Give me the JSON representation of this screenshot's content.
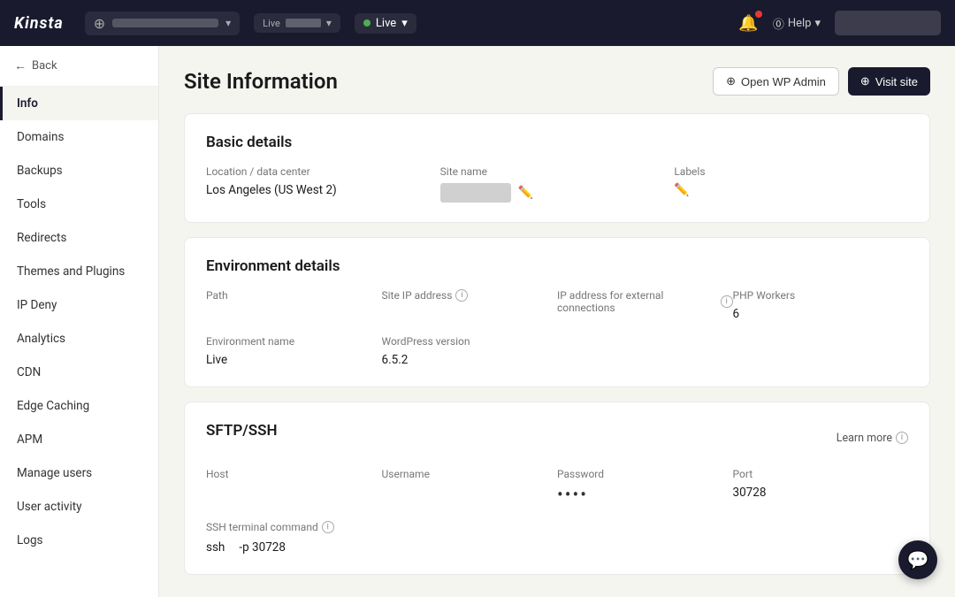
{
  "topnav": {
    "logo": "Kinsta",
    "wp_icon": "⊕",
    "env_label": "Live",
    "env_chevron": "▾",
    "help_label": "Help",
    "help_chevron": "▾"
  },
  "sidebar": {
    "back_label": "Back",
    "items": [
      {
        "id": "info",
        "label": "Info",
        "active": true
      },
      {
        "id": "domains",
        "label": "Domains",
        "active": false
      },
      {
        "id": "backups",
        "label": "Backups",
        "active": false
      },
      {
        "id": "tools",
        "label": "Tools",
        "active": false
      },
      {
        "id": "redirects",
        "label": "Redirects",
        "active": false
      },
      {
        "id": "themes-plugins",
        "label": "Themes and Plugins",
        "active": false
      },
      {
        "id": "ip-deny",
        "label": "IP Deny",
        "active": false
      },
      {
        "id": "analytics",
        "label": "Analytics",
        "active": false
      },
      {
        "id": "cdn",
        "label": "CDN",
        "active": false
      },
      {
        "id": "edge-caching",
        "label": "Edge Caching",
        "active": false
      },
      {
        "id": "apm",
        "label": "APM",
        "active": false
      },
      {
        "id": "manage-users",
        "label": "Manage users",
        "active": false
      },
      {
        "id": "user-activity",
        "label": "User activity",
        "active": false
      },
      {
        "id": "logs",
        "label": "Logs",
        "active": false
      }
    ]
  },
  "page": {
    "title": "Site Information",
    "btn_open_wp_admin": "Open WP Admin",
    "btn_visit_site": "Visit site"
  },
  "basic_details": {
    "section_title": "Basic details",
    "location_label": "Location / data center",
    "location_value": "Los Angeles (US West 2)",
    "site_name_label": "Site name",
    "labels_label": "Labels"
  },
  "environment_details": {
    "section_title": "Environment details",
    "path_label": "Path",
    "path_value": "",
    "site_ip_label": "Site IP address",
    "site_ip_value": "",
    "ext_ip_label": "IP address for external connections",
    "ext_ip_value": "",
    "php_workers_label": "PHP Workers",
    "php_workers_value": "6",
    "env_name_label": "Environment name",
    "env_name_value": "Live",
    "wp_version_label": "WordPress version",
    "wp_version_value": "6.5.2"
  },
  "sftp": {
    "section_title": "SFTP/SSH",
    "learn_more_label": "Learn more",
    "host_label": "Host",
    "host_value": "",
    "username_label": "Username",
    "username_value": "",
    "password_label": "Password",
    "password_value": "••••",
    "port_label": "Port",
    "port_value": "30728",
    "ssh_terminal_label": "SSH terminal command",
    "ssh_cmd_part1": "ssh",
    "ssh_cmd_part2": "-p 30728"
  },
  "chat": {
    "icon": "💬"
  }
}
